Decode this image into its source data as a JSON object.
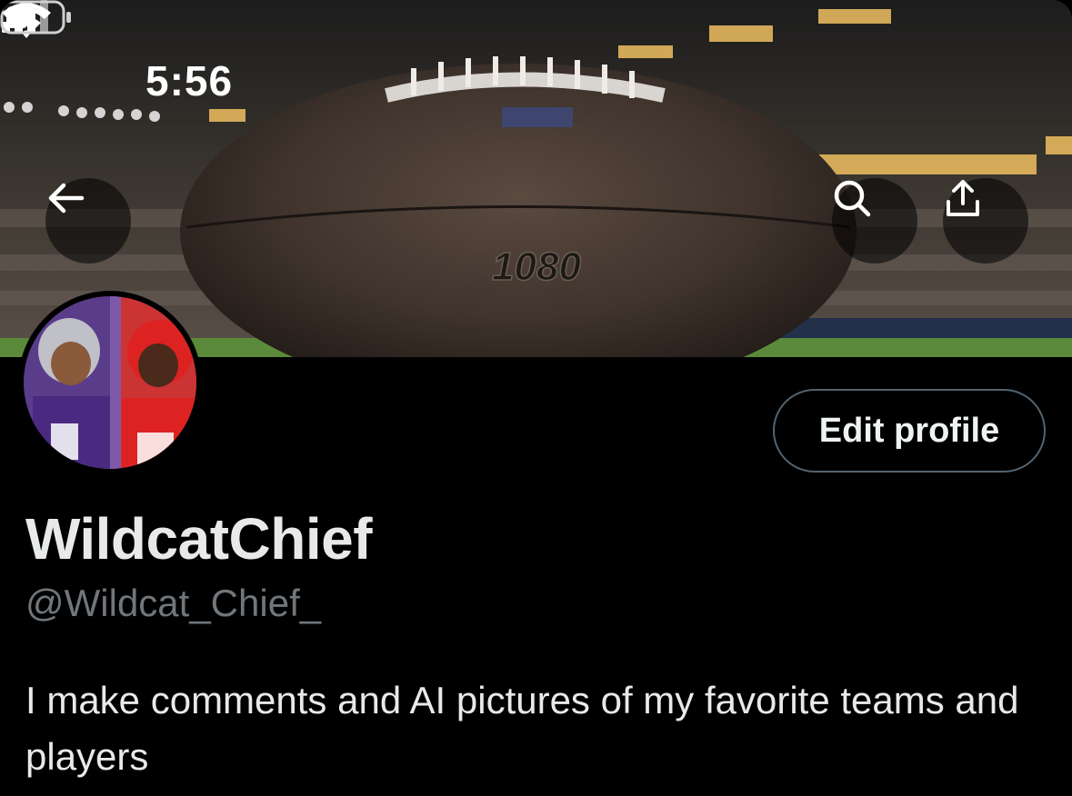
{
  "status_bar": {
    "time": "5:56",
    "icons": [
      "signal-icon",
      "wifi-icon",
      "battery-icon"
    ]
  },
  "banner": {
    "ball_text": "1080",
    "icons": [
      "back-arrow-icon",
      "search-icon",
      "share-icon"
    ]
  },
  "profile": {
    "display_name": "WildcatChief",
    "handle": "@Wildcat_Chief_",
    "bio": "I make comments and AI pictures of my favorite teams and players",
    "edit_button_label": "Edit profile"
  },
  "colors": {
    "background": "#000000",
    "text_primary": "#e7e9ea",
    "text_secondary": "#71767b",
    "button_border": "#536471"
  }
}
